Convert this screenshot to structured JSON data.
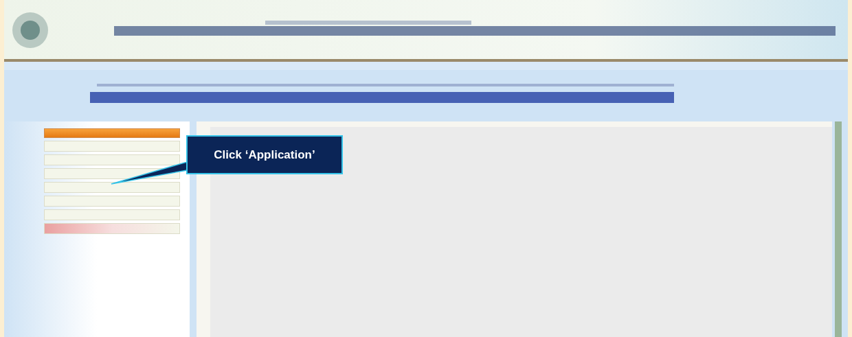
{
  "menu": {
    "items": [
      {
        "kind": "header"
      },
      {
        "kind": "item"
      },
      {
        "kind": "item"
      },
      {
        "kind": "item"
      },
      {
        "kind": "item"
      },
      {
        "kind": "item"
      },
      {
        "kind": "item"
      },
      {
        "kind": "alert"
      }
    ]
  },
  "callout": {
    "text": "Click ‘Application’"
  }
}
